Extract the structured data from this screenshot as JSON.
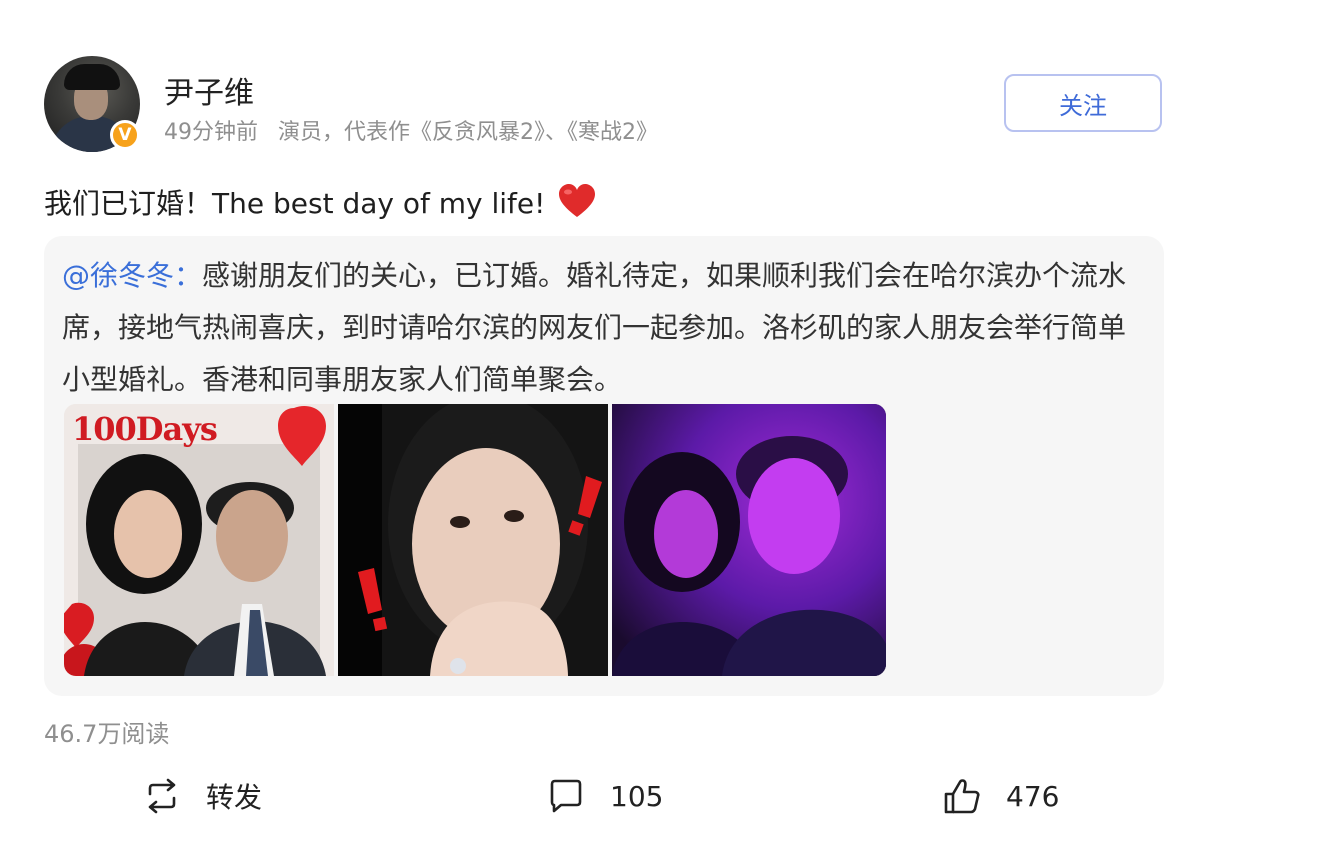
{
  "author": {
    "name": "尹子维",
    "time": "49分钟前",
    "description": "演员，代表作《反贪风暴2》、《寒战2》",
    "verified_badge": "V",
    "follow_label": "关注"
  },
  "post": {
    "text": "我们已订婚！The best day of my life!",
    "emoji": "heart-emoji"
  },
  "repost": {
    "mention": "@徐冬冬",
    "separator": "：",
    "text": "感谢朋友们的关心，已订婚。婚礼待定，如果顺利我们会在哈尔滨办个流水席，接地气热闹喜庆，到时请哈尔滨的网友们一起参加。洛杉矶的家人朋友会举行简单小型婚礼。香港和同事朋友家人们简单聚会。",
    "images": [
      {
        "name": "100 Days couple selfie",
        "overlay_text": "100Days"
      },
      {
        "name": "woman hand-on-face selfie with ring"
      },
      {
        "name": "couple selfie purple light"
      }
    ]
  },
  "stats": {
    "reads": "46.7万阅读"
  },
  "actions": {
    "repost_label": "转发",
    "comment_count": "105",
    "like_count": "476"
  },
  "colors": {
    "accent_blue": "#3a6fd9",
    "follow_border": "#b8c2f0",
    "badge_orange": "#f7a21b",
    "meta_gray": "#8f8f8f",
    "repost_bg": "#f6f6f6"
  },
  "icons": [
    "verified-v-icon",
    "heart-emoji",
    "repost-icon",
    "comment-icon",
    "like-icon"
  ]
}
